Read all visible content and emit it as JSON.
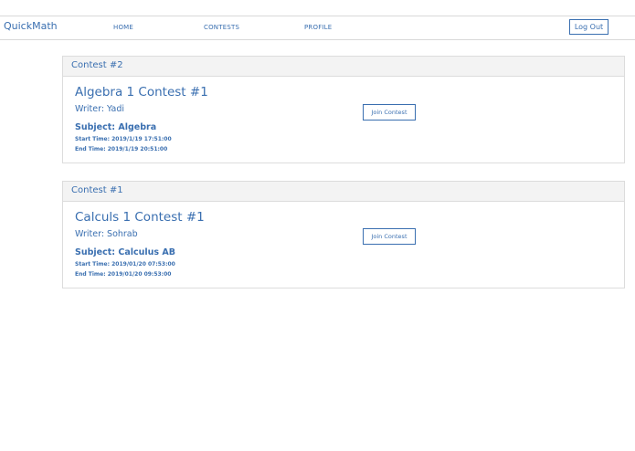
{
  "navbar": {
    "brand": "QuickMath",
    "links": [
      "HOME",
      "CONTESTS",
      "PROFILE"
    ],
    "logout_label": "Log Out"
  },
  "contests": [
    {
      "header": "Contest #2",
      "title": "Algebra 1 Contest #1",
      "writer": "Writer: Yadi",
      "subject": "Subject: Algebra",
      "start_time": "Start Time: 2019/1/19 17:51:00",
      "end_time": "End Time: 2019/1/19 20:51:00",
      "join_label": "Join Contest"
    },
    {
      "header": "Contest #1",
      "title": "Calculs 1 Contest #1",
      "writer": "Writer: Sohrab",
      "subject": "Subject: Calculus AB",
      "start_time": "Start Time: 2019/01/20 07:53:00",
      "end_time": "End Time: 2019/01/20 09:53:00",
      "join_label": "Join Contest"
    }
  ],
  "colors": {
    "accent": "#3a6fb0",
    "card_header_bg": "#f3f3f3",
    "border": "#dcdcdc"
  }
}
